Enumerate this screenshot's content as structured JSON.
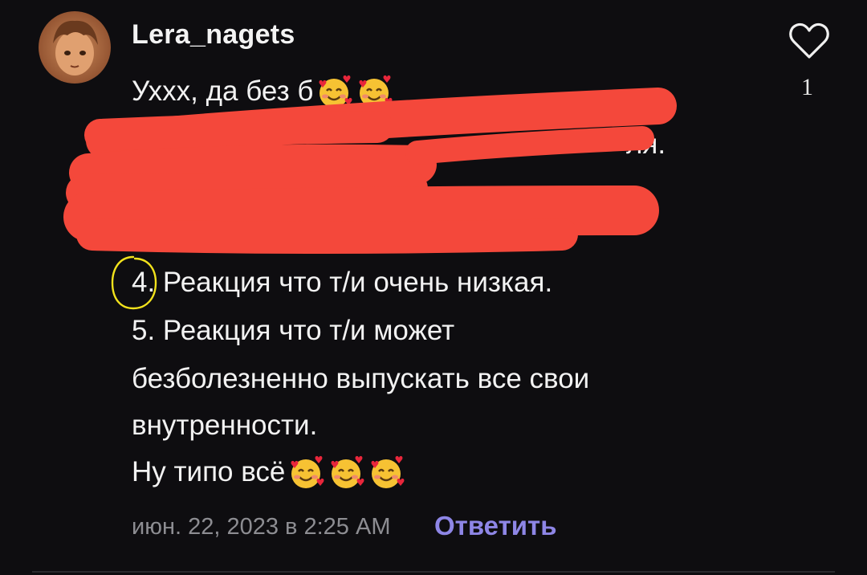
{
  "comment": {
    "username": "Lera_nagets",
    "like_count": "1",
    "lines": [
      "Ухxx, да без б",
      "4. Реакция что т/и очень низкая.",
      "5. Реакция что т/и может",
      "безболезненно выпускать все  свои",
      "внутренности.",
      "Ну типо всё"
    ],
    "partial_text": "ля.",
    "timestamp": "июн. 22, 2023 в 2:25 AM",
    "reply_label": "Ответить"
  },
  "icons": {
    "like": "heart-outline-icon",
    "emoji": "smiling-face-with-hearts-emoji"
  },
  "colors": {
    "background": "#0e0d10",
    "reply_accent": "#8e86e6",
    "redaction": "#f4483b",
    "annotation_circle": "#f2e21c"
  }
}
